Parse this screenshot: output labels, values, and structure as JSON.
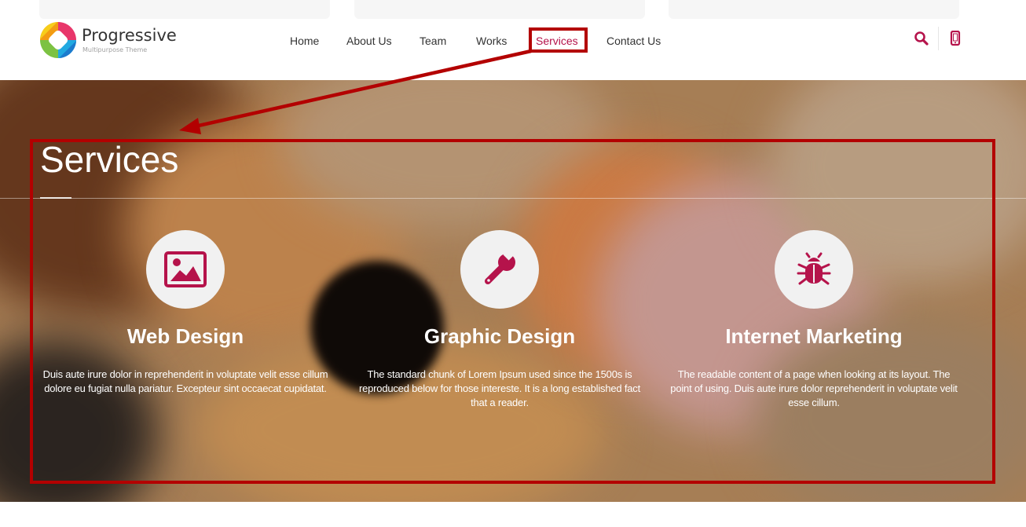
{
  "brand": {
    "name": "Progressive",
    "tagline": "Multipurpose Theme"
  },
  "nav": {
    "items": [
      {
        "label": "Home"
      },
      {
        "label": "About Us"
      },
      {
        "label": "Team"
      },
      {
        "label": "Works"
      },
      {
        "label": "Services"
      },
      {
        "label": "Contact Us"
      }
    ],
    "active": "Services"
  },
  "header_icons": [
    "search-icon",
    "mobile-phone-icon"
  ],
  "hero": {
    "title": "Services"
  },
  "services": [
    {
      "icon": "image-icon",
      "title": "Web Design",
      "text": "Duis aute irure dolor in reprehenderit in voluptate velit esse cillum dolore eu fugiat nulla pariatur. Excepteur sint occaecat cupidatat."
    },
    {
      "icon": "wrench-icon",
      "title": "Graphic Design",
      "text": "The standard chunk of Lorem Ipsum used since the 1500s is reproduced below for those intereste. It is a long established fact that a reader."
    },
    {
      "icon": "bug-icon",
      "title": "Internet Marketing",
      "text": "The readable content of a page when looking at its layout. The point of using. Duis aute irure dolor reprehenderit in voluptate velit esse cillum."
    }
  ],
  "colors": {
    "accent": "#b5134b",
    "annotation": "#b30000"
  }
}
